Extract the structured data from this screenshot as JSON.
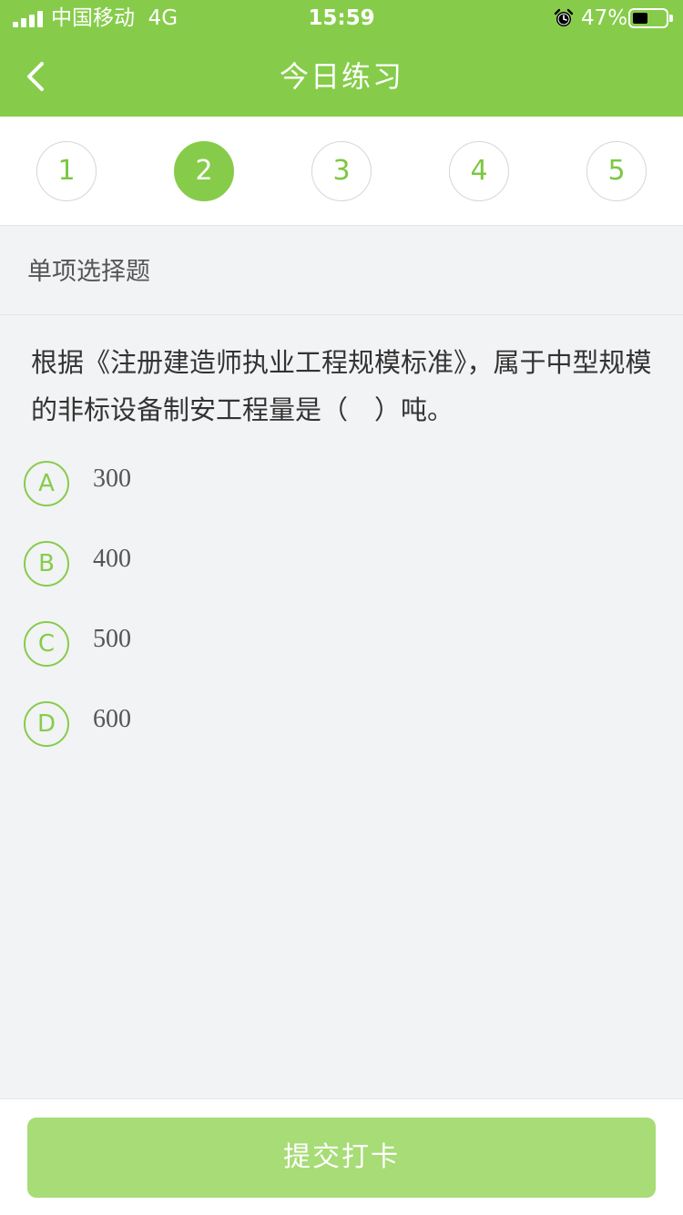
{
  "status_bar": {
    "carrier": "中国移动",
    "network": "4G",
    "time": "15:59",
    "battery_percent": "47%",
    "icons": [
      "signal-icon",
      "alarm-icon",
      "battery-icon"
    ]
  },
  "nav": {
    "title": "今日练习",
    "back_icon": "chevron-left-icon"
  },
  "question_numbers": {
    "items": [
      "1",
      "2",
      "3",
      "4",
      "5"
    ],
    "active_index": 1
  },
  "section": {
    "label": "单项选择题"
  },
  "question": {
    "text": "根据《注册建造师执业工程规模标准》，属于中型规模的非标设备制安工程量是（　）吨。",
    "options": [
      {
        "letter": "A",
        "text": "300"
      },
      {
        "letter": "B",
        "text": "400"
      },
      {
        "letter": "C",
        "text": "500"
      },
      {
        "letter": "D",
        "text": "600"
      }
    ]
  },
  "footer": {
    "submit_label": "提交打卡"
  },
  "colors": {
    "brand_green": "#86cc4a",
    "button_green_light": "#a7dc76",
    "background": "#f2f3f5"
  }
}
